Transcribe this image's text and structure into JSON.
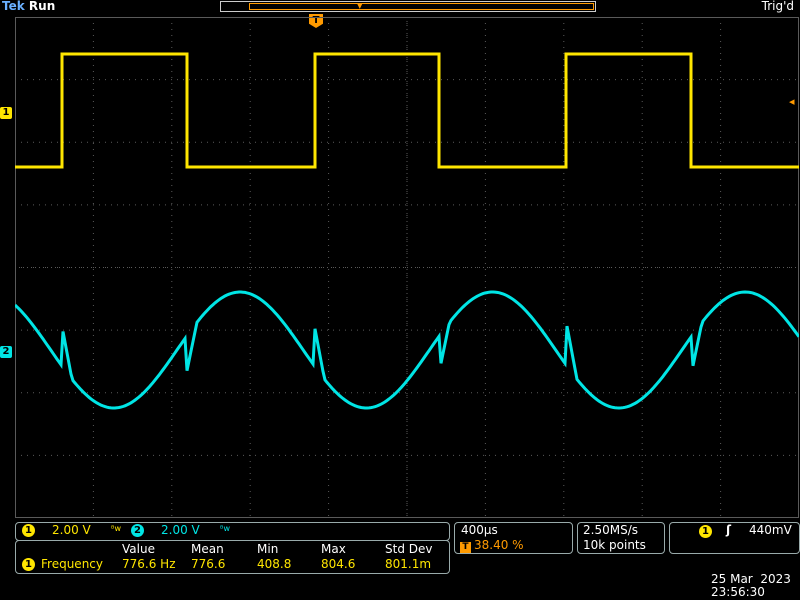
{
  "top": {
    "brand": "Tek",
    "run_state": "Run",
    "trigger_status": "Trig'd"
  },
  "markers": {
    "ch1": "1",
    "ch2": "2",
    "trigger_pos": "T",
    "trigger_level": "◂"
  },
  "vertical": {
    "ch1_num": "1",
    "ch1_scale": "2.00 V",
    "ch1_bw": "ᴮw",
    "ch2_num": "2",
    "ch2_scale": "2.00 V",
    "ch2_bw": "ᴮw"
  },
  "horizontal": {
    "time_div": "400µs",
    "trigger_pct_icon": "T",
    "trigger_pct": "38.40 %"
  },
  "sampling": {
    "rate": "2.50MS/s",
    "points": "10k points"
  },
  "trigger": {
    "source": "1",
    "slope": "ʃ",
    "level": "440mV"
  },
  "measurements": {
    "headers": [
      "Value",
      "Mean",
      "Min",
      "Max",
      "Std Dev"
    ],
    "rows": [
      {
        "source": "1",
        "name": "Frequency",
        "value": "776.6 Hz",
        "mean": "776.6",
        "min": "408.8",
        "max": "804.6",
        "std_dev": "801.1m"
      }
    ]
  },
  "datetime": {
    "date": "25 Mar  2023",
    "time": "23:56:30"
  },
  "colors": {
    "ch1": "#ffe600",
    "ch2": "#00e5e5",
    "trigger": "#ff9a00",
    "grid": "#5a5a5a"
  }
}
